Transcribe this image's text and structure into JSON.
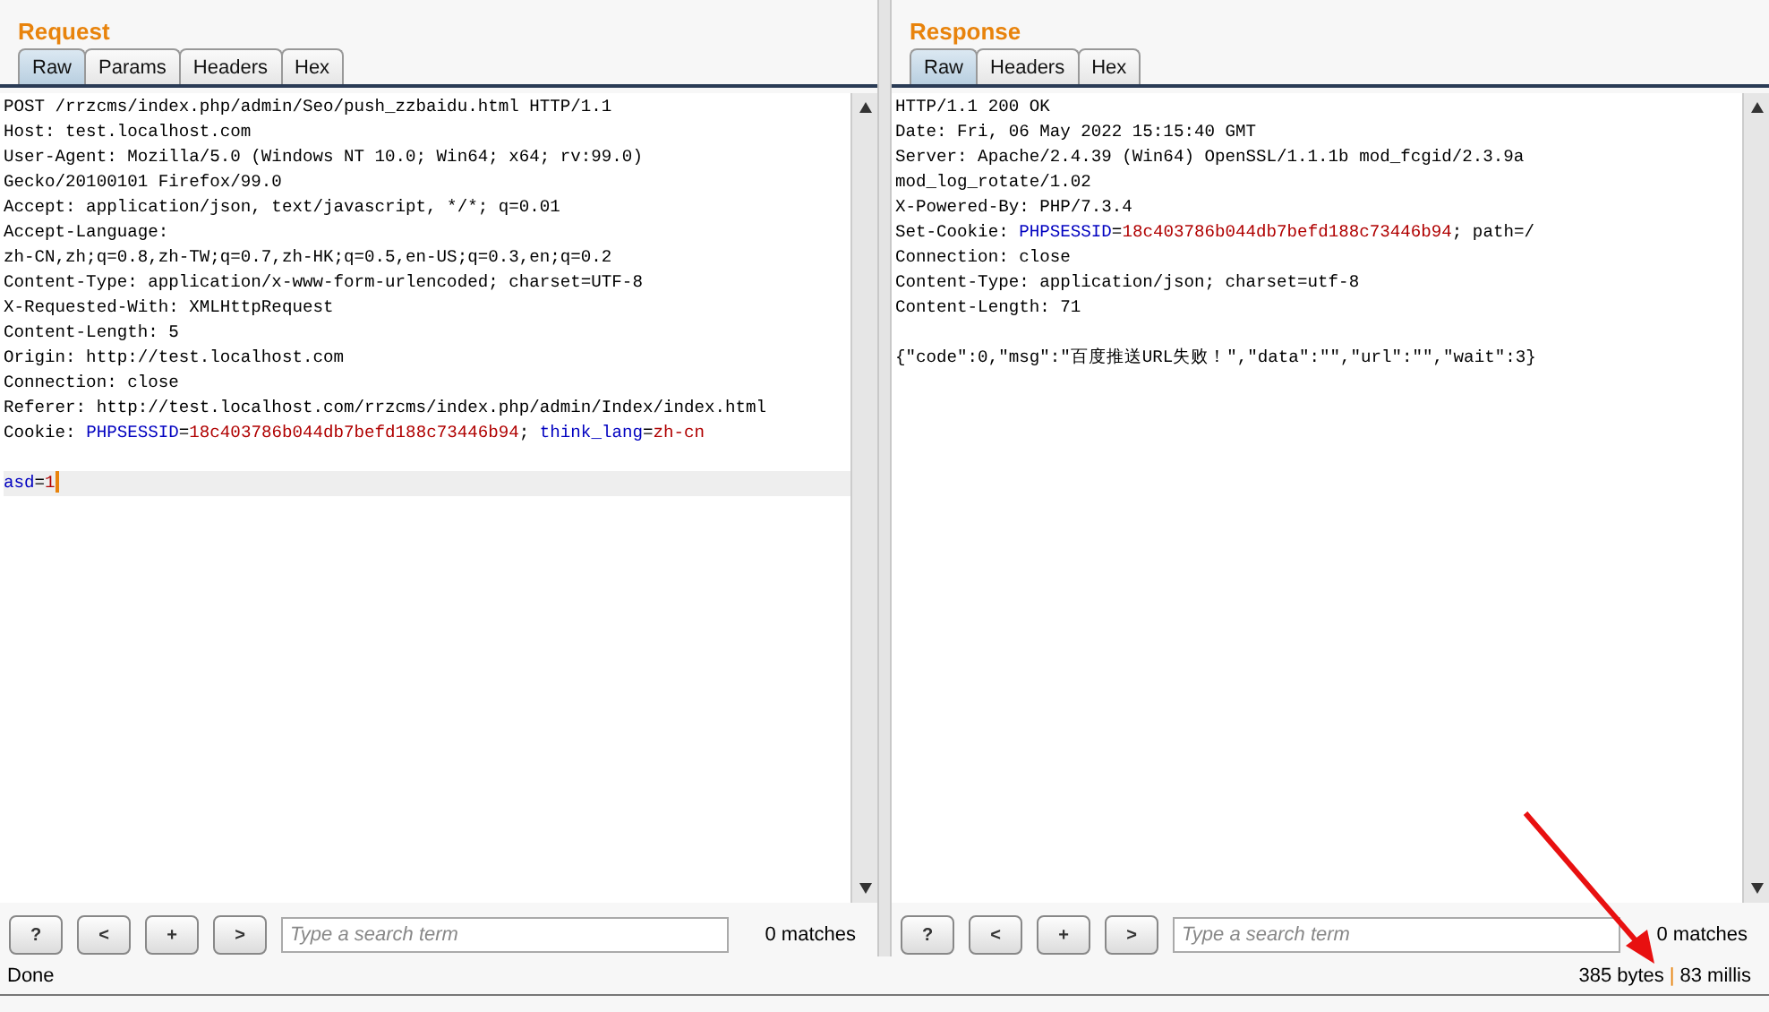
{
  "panes": [
    {
      "title": "Request",
      "tabs": [
        {
          "label": "Raw",
          "selected": true
        },
        {
          "label": "Params",
          "selected": false
        },
        {
          "label": "Headers",
          "selected": false
        },
        {
          "label": "Hex",
          "selected": false
        }
      ],
      "lines": [
        {
          "segments": [
            {
              "kind": "plain",
              "text": "POST /rrzcms/index.php/admin/Seo/push_zzbaidu.html HTTP/1.1"
            }
          ]
        },
        {
          "segments": [
            {
              "kind": "plain",
              "text": "Host: test.localhost.com"
            }
          ]
        },
        {
          "segments": [
            {
              "kind": "plain",
              "text": "User-Agent: Mozilla/5.0 (Windows NT 10.0; Win64; x64; rv:99.0)"
            }
          ]
        },
        {
          "segments": [
            {
              "kind": "plain",
              "text": "Gecko/20100101 Firefox/99.0"
            }
          ]
        },
        {
          "segments": [
            {
              "kind": "plain",
              "text": "Accept: application/json, text/javascript, */*; q=0.01"
            }
          ]
        },
        {
          "segments": [
            {
              "kind": "plain",
              "text": "Accept-Language:"
            }
          ]
        },
        {
          "segments": [
            {
              "kind": "plain",
              "text": "zh-CN,zh;q=0.8,zh-TW;q=0.7,zh-HK;q=0.5,en-US;q=0.3,en;q=0.2"
            }
          ]
        },
        {
          "segments": [
            {
              "kind": "plain",
              "text": "Content-Type: application/x-www-form-urlencoded; charset=UTF-8"
            }
          ]
        },
        {
          "segments": [
            {
              "kind": "plain",
              "text": "X-Requested-With: XMLHttpRequest"
            }
          ]
        },
        {
          "segments": [
            {
              "kind": "plain",
              "text": "Content-Length: 5"
            }
          ]
        },
        {
          "segments": [
            {
              "kind": "plain",
              "text": "Origin: http://test.localhost.com"
            }
          ]
        },
        {
          "segments": [
            {
              "kind": "plain",
              "text": "Connection: close"
            }
          ]
        },
        {
          "segments": [
            {
              "kind": "plain",
              "text": "Referer: http://test.localhost.com/rrzcms/index.php/admin/Index/index.html"
            }
          ]
        },
        {
          "segments": [
            {
              "kind": "plain",
              "text": "Cookie: "
            },
            {
              "kind": "name",
              "text": "PHPSESSID"
            },
            {
              "kind": "plain",
              "text": "="
            },
            {
              "kind": "value",
              "text": "18c403786b044db7befd188c73446b94"
            },
            {
              "kind": "plain",
              "text": "; "
            },
            {
              "kind": "name",
              "text": "think_lang"
            },
            {
              "kind": "plain",
              "text": "="
            },
            {
              "kind": "value",
              "text": "zh-cn"
            }
          ]
        },
        {
          "segments": [
            {
              "kind": "name",
              "text": "asd"
            },
            {
              "kind": "plain",
              "text": "="
            },
            {
              "kind": "value",
              "text": "1"
            }
          ],
          "cursor": true,
          "blank_line_before": true
        }
      ],
      "search": {
        "placeholder": "Type a search term"
      },
      "buttons": [
        "?",
        "<",
        "+",
        ">"
      ],
      "matches": "0 matches"
    },
    {
      "title": "Response",
      "tabs": [
        {
          "label": "Raw",
          "selected": true
        },
        {
          "label": "Headers",
          "selected": false
        },
        {
          "label": "Hex",
          "selected": false
        }
      ],
      "lines": [
        {
          "segments": [
            {
              "kind": "plain",
              "text": "HTTP/1.1 200 OK"
            }
          ]
        },
        {
          "segments": [
            {
              "kind": "plain",
              "text": "Date: Fri, 06 May 2022 15:15:40 GMT"
            }
          ]
        },
        {
          "segments": [
            {
              "kind": "plain",
              "text": "Server: Apache/2.4.39 (Win64) OpenSSL/1.1.1b mod_fcgid/2.3.9a"
            }
          ]
        },
        {
          "segments": [
            {
              "kind": "plain",
              "text": "mod_log_rotate/1.02"
            }
          ]
        },
        {
          "segments": [
            {
              "kind": "plain",
              "text": "X-Powered-By: PHP/7.3.4"
            }
          ]
        },
        {
          "segments": [
            {
              "kind": "plain",
              "text": "Set-Cookie: "
            },
            {
              "kind": "name",
              "text": "PHPSESSID"
            },
            {
              "kind": "plain",
              "text": "="
            },
            {
              "kind": "value",
              "text": "18c403786b044db7befd188c73446b94"
            },
            {
              "kind": "plain",
              "text": "; path=/"
            }
          ]
        },
        {
          "segments": [
            {
              "kind": "plain",
              "text": "Connection: close"
            }
          ]
        },
        {
          "segments": [
            {
              "kind": "plain",
              "text": "Content-Type: application/json; charset=utf-8"
            }
          ]
        },
        {
          "segments": [
            {
              "kind": "plain",
              "text": "Content-Length: 71"
            }
          ]
        },
        {
          "segments": [
            {
              "kind": "plain",
              "text": "{\"code\":0,\"msg\":\"百度推送URL失败！\",\"data\":\"\",\"url\":\"\",\"wait\":3}"
            }
          ],
          "blank_line_before": true
        }
      ],
      "search": {
        "placeholder": "Type a search term"
      },
      "buttons": [
        "?",
        "<",
        "+",
        ">"
      ],
      "matches": "0 matches"
    }
  ],
  "status_bar": {
    "status": "Done",
    "size": "385 bytes",
    "separator": "|",
    "time": "83 millis"
  }
}
